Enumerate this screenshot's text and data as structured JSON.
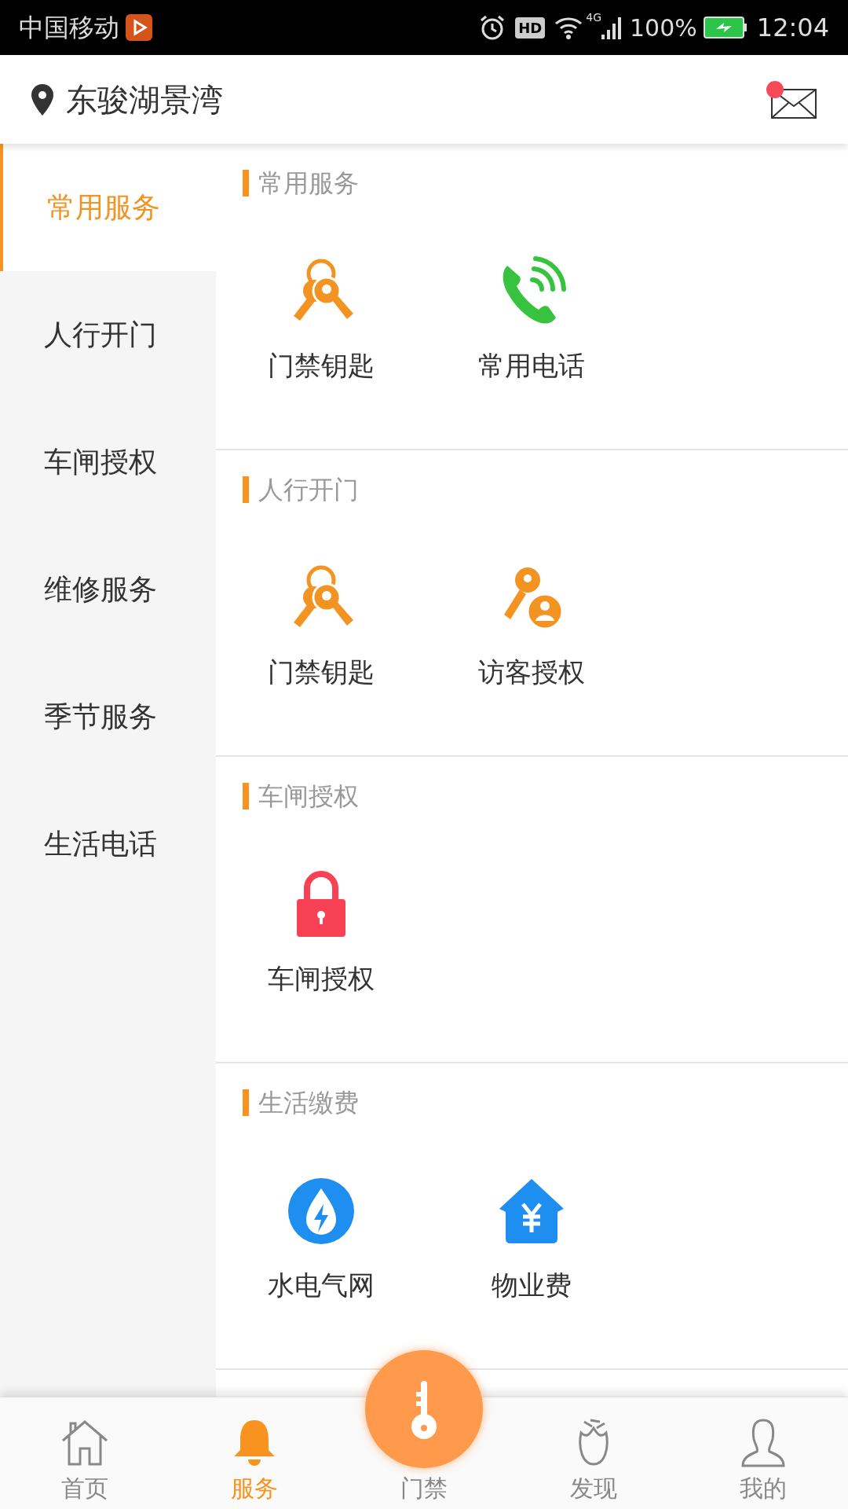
{
  "status_bar": {
    "carrier": "中国移动",
    "hd": "HD",
    "network": "4G",
    "battery": "100%",
    "time": "12:04"
  },
  "header": {
    "location": "东骏湖景湾",
    "has_unread": true
  },
  "sidebar": {
    "items": [
      {
        "label": "常用服务",
        "selected": true
      },
      {
        "label": "人行开门",
        "selected": false
      },
      {
        "label": "车闸授权",
        "selected": false
      },
      {
        "label": "维修服务",
        "selected": false
      },
      {
        "label": "季节服务",
        "selected": false
      },
      {
        "label": "生活电话",
        "selected": false
      }
    ]
  },
  "sections": [
    {
      "title": "常用服务",
      "items": [
        {
          "label": "门禁钥匙",
          "kind": "keys"
        },
        {
          "label": "常用电话",
          "kind": "phone"
        }
      ]
    },
    {
      "title": "人行开门",
      "items": [
        {
          "label": "门禁钥匙",
          "kind": "keys"
        },
        {
          "label": "访客授权",
          "kind": "visitor"
        }
      ]
    },
    {
      "title": "车闸授权",
      "items": [
        {
          "label": "车闸授权",
          "kind": "lock"
        }
      ]
    },
    {
      "title": "生活缴费",
      "items": [
        {
          "label": "水电气网",
          "kind": "utility"
        },
        {
          "label": "物业费",
          "kind": "fee"
        }
      ]
    }
  ],
  "tab_bar": [
    {
      "label": "首页",
      "kind": "home",
      "selected": false
    },
    {
      "label": "服务",
      "kind": "bell",
      "selected": true
    },
    {
      "label": "门禁",
      "kind": "key",
      "selected": false
    },
    {
      "label": "发现",
      "kind": "flower",
      "selected": false
    },
    {
      "label": "我的",
      "kind": "person",
      "selected": false
    }
  ]
}
